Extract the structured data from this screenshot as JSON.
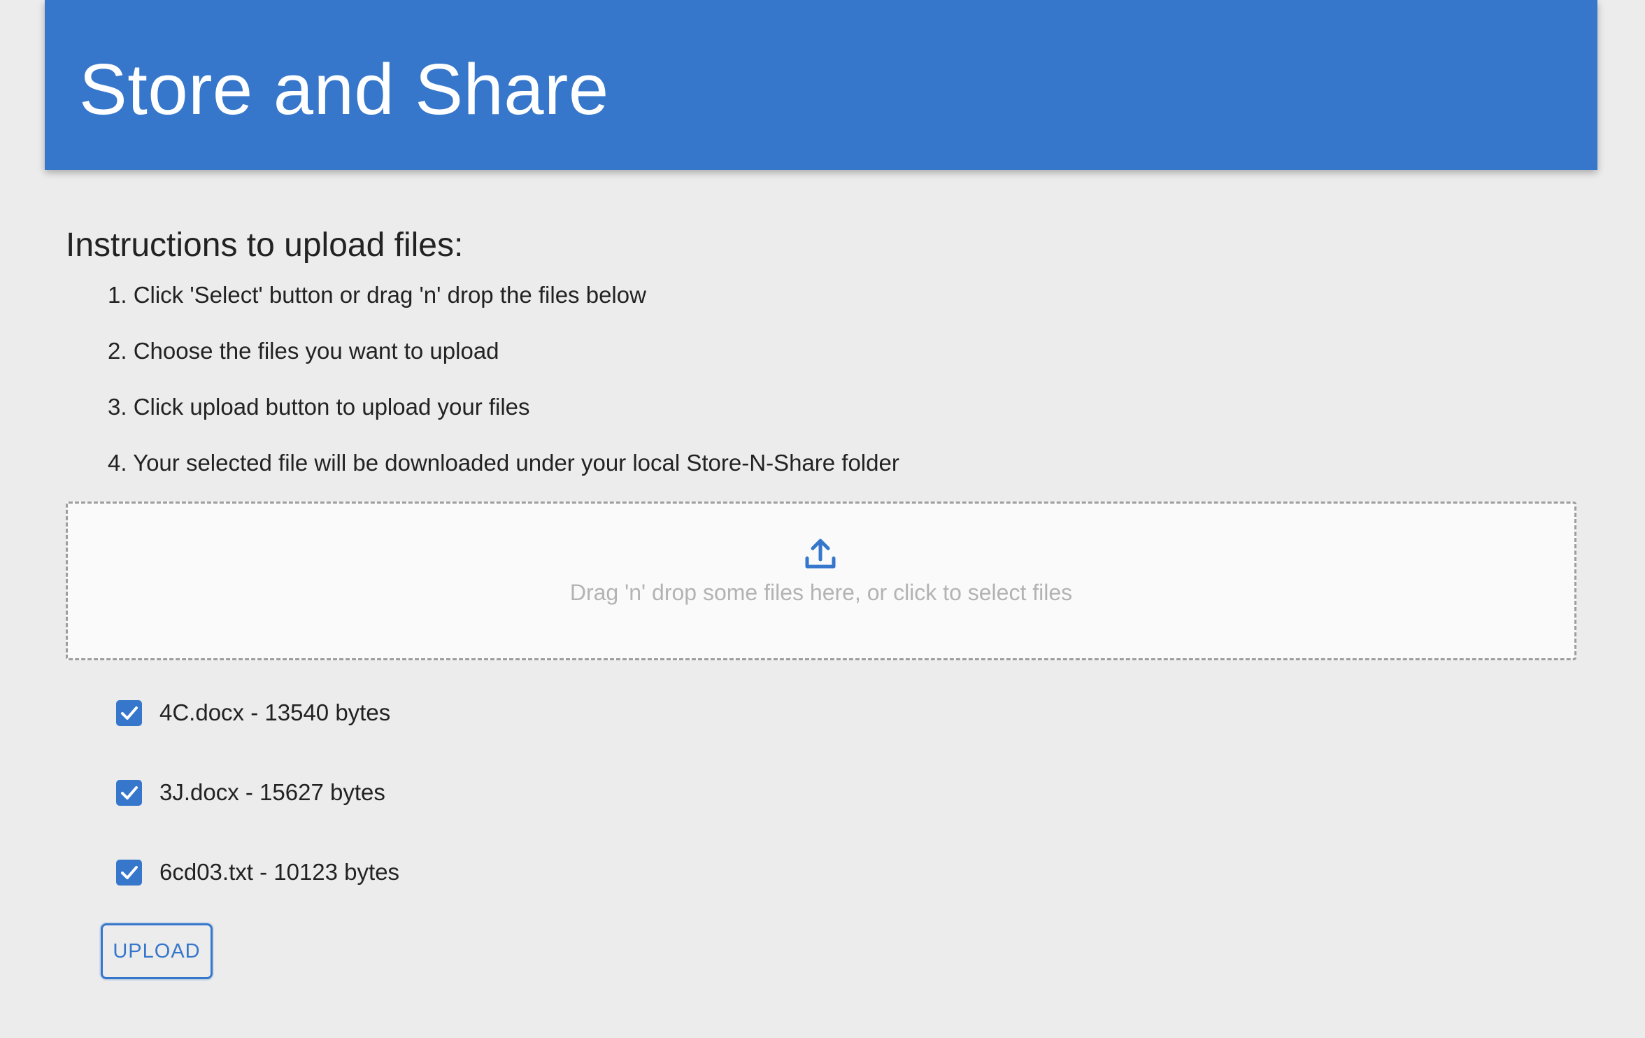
{
  "app": {
    "title": "Store and Share",
    "accent_color": "#3677cc"
  },
  "instructions": {
    "heading": "Instructions to upload files:",
    "steps": [
      "1. Click 'Select' button or drag 'n' drop the files below",
      "2. Choose the files you want to upload",
      "3. Click upload button to upload your files",
      "4. Your selected file will be downloaded under your local Store-N-Share folder"
    ]
  },
  "dropzone": {
    "icon": "upload-icon",
    "text": "Drag 'n' drop some files here, or click to select files"
  },
  "files": [
    {
      "label": "4C.docx - 13540 bytes",
      "checked": true
    },
    {
      "label": "3J.docx - 15627 bytes",
      "checked": true
    },
    {
      "label": "6cd03.txt - 10123 bytes",
      "checked": true
    }
  ],
  "upload_button": {
    "label": "UPLOAD"
  }
}
